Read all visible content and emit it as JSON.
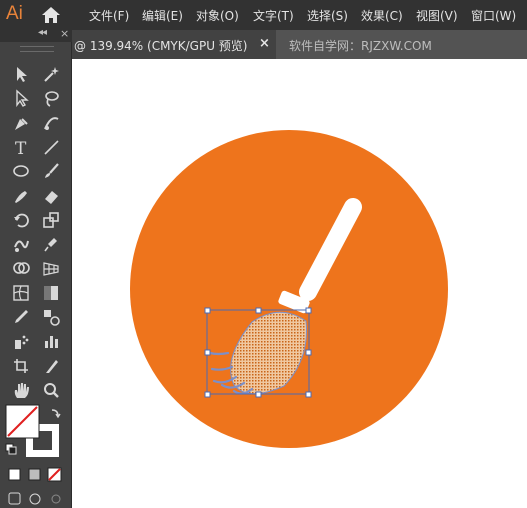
{
  "app": {
    "logo": "Ai"
  },
  "menu": [
    {
      "label": "文件(F)"
    },
    {
      "label": "编辑(E)"
    },
    {
      "label": "对象(O)"
    },
    {
      "label": "文字(T)"
    },
    {
      "label": "选择(S)"
    },
    {
      "label": "效果(C)"
    },
    {
      "label": "视图(V)"
    },
    {
      "label": "窗口(W)"
    }
  ],
  "tabs": {
    "active": {
      "title": "@ 139.94% (CMYK/GPU 预览)",
      "close": "×"
    },
    "inactive": {
      "title": "软件自学网：RJZXW.COM"
    }
  },
  "panel": {
    "collapse": "◂◂",
    "close": "×"
  },
  "colors": {
    "menubar": "#323232",
    "panel": "#424242",
    "circle": "#ee741c",
    "handle": "#ffffff",
    "selection": "#4a6ab3"
  },
  "tools": [
    {
      "name": "selection-tool-icon"
    },
    {
      "name": "magic-wand-icon"
    },
    {
      "name": "direct-selection-icon"
    },
    {
      "name": "lasso-icon"
    },
    {
      "name": "pen-tool-icon"
    },
    {
      "name": "curvature-tool-icon"
    },
    {
      "name": "type-tool-icon",
      "glyph": "T"
    },
    {
      "name": "line-tool-icon"
    },
    {
      "name": "ellipse-tool-icon"
    },
    {
      "name": "paintbrush-icon"
    },
    {
      "name": "blob-brush-icon"
    },
    {
      "name": "eraser-icon"
    },
    {
      "name": "rotate-tool-icon"
    },
    {
      "name": "scale-tool-icon"
    },
    {
      "name": "warp-tool-icon"
    },
    {
      "name": "puppet-warp-icon"
    },
    {
      "name": "shape-builder-icon"
    },
    {
      "name": "perspective-grid-icon"
    },
    {
      "name": "mesh-tool-icon"
    },
    {
      "name": "gradient-tool-icon"
    },
    {
      "name": "eyedropper-icon"
    },
    {
      "name": "blend-tool-icon"
    },
    {
      "name": "symbol-sprayer-icon"
    },
    {
      "name": "column-graph-icon"
    },
    {
      "name": "artboard-tool-icon"
    },
    {
      "name": "slice-tool-icon"
    },
    {
      "name": "hand-tool-icon"
    },
    {
      "name": "zoom-tool-icon"
    }
  ]
}
